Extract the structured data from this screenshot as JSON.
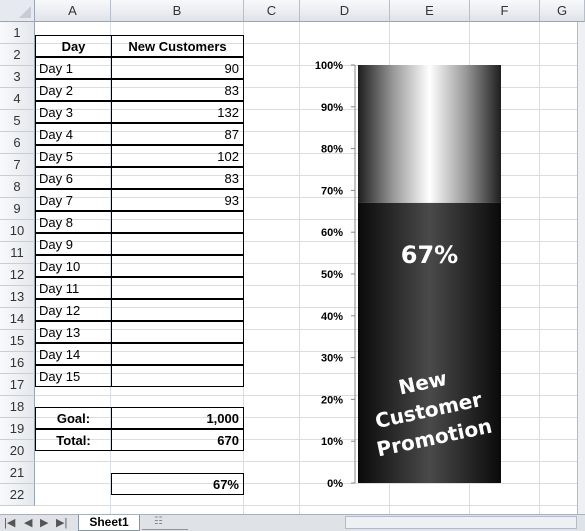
{
  "columns": [
    "A",
    "B",
    "C",
    "D",
    "E",
    "F",
    "G"
  ],
  "rows": [
    "1",
    "2",
    "3",
    "4",
    "5",
    "6",
    "7",
    "8",
    "9",
    "10",
    "11",
    "12",
    "13",
    "14",
    "15",
    "16",
    "17",
    "18",
    "19",
    "20",
    "21",
    "22"
  ],
  "table": {
    "header_day": "Day",
    "header_customers": "New Customers",
    "days": [
      "Day 1",
      "Day 2",
      "Day 3",
      "Day 4",
      "Day 5",
      "Day 6",
      "Day 7",
      "Day 8",
      "Day 9",
      "Day 10",
      "Day 11",
      "Day 12",
      "Day 13",
      "Day 14",
      "Day 15"
    ],
    "customers": [
      "90",
      "83",
      "132",
      "87",
      "102",
      "83",
      "93",
      "",
      "",
      "",
      "",
      "",
      "",
      "",
      ""
    ],
    "goal_label": "Goal:",
    "goal_value": "1,000",
    "total_label": "Total:",
    "total_value": "670",
    "percent_value": "67%"
  },
  "chart_data": {
    "type": "bar",
    "categories": [
      ""
    ],
    "values": [
      0.67
    ],
    "ylim": [
      0,
      1
    ],
    "yticks": [
      "0%",
      "10%",
      "20%",
      "30%",
      "40%",
      "50%",
      "60%",
      "70%",
      "80%",
      "90%",
      "100%"
    ],
    "data_label": "67%",
    "bar_text": [
      "New",
      "Customer",
      "Promotion"
    ],
    "colors": {
      "filled": "#1a1a1a",
      "empty": "#d9d9d9"
    }
  },
  "tabs": {
    "sheet1": "Sheet1",
    "nav_buttons": [
      "|◀",
      "◀",
      "▶",
      "▶|"
    ]
  }
}
